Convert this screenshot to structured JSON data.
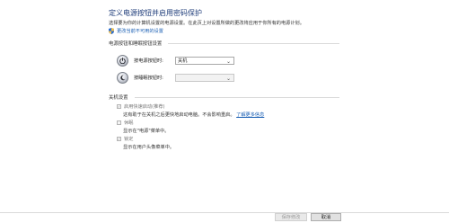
{
  "page": {
    "title": "定义电源按钮并启用密码保护",
    "description": "选择要为你的计算机设置的电源设置。在此页上对设置所做的更改将应用于你所有的电源计划。",
    "change_unavailable_link": "更改当前不可用的设置"
  },
  "power_buttons": {
    "section_label": "电源按钮和睡眠按钮设置",
    "power_button_label": "按电源按钮时:",
    "power_button_value": "关机",
    "sleep_button_label": "按睡眠按钮时:",
    "sleep_button_value": ""
  },
  "shutdown": {
    "section_label": "关机设置",
    "options": [
      {
        "label": "启用快速启动(推荐)",
        "checked": true,
        "description": "这有助于在关机之后更快地启动电脑。不会影响重启。",
        "link": "了解更多信息"
      },
      {
        "label": "休眠",
        "checked": false,
        "description": "显示在\"电源\"菜单中。"
      },
      {
        "label": "锁定",
        "checked": true,
        "description": "显示在用户头像菜单中。"
      }
    ]
  },
  "footer": {
    "save_label": "保存修改",
    "cancel_label": "取消"
  },
  "colors": {
    "title": "#1f3d7a",
    "link": "#1a5fb4",
    "background": "#ffffff"
  },
  "icons": {
    "shield": "uac-shield-icon",
    "power_button": "power-button-icon",
    "sleep_button": "sleep-moon-icon",
    "dropdown": "chevron-down-icon"
  }
}
